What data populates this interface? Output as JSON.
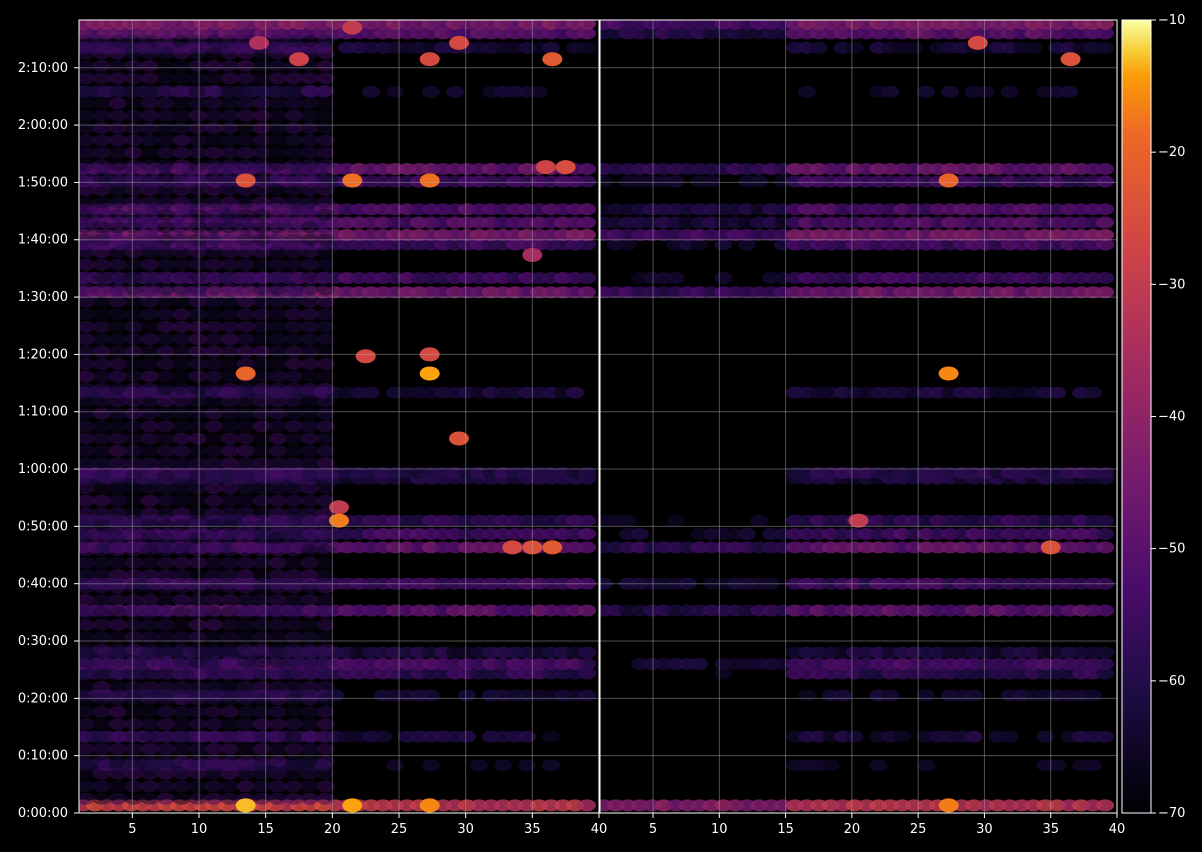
{
  "chart_data": {
    "type": "heatmap",
    "panels": [
      {
        "name": "",
        "xlim": [
          1,
          40
        ]
      },
      {
        "name": "",
        "xlim": [
          1,
          40
        ]
      }
    ],
    "x_ticks": [
      5,
      10,
      15,
      20,
      25,
      30,
      35,
      40
    ],
    "x_tick_labels": [
      "5",
      "10",
      "15",
      "20",
      "25",
      "30",
      "35",
      "40"
    ],
    "y_unit": "elapsed time (h:mm:ss)",
    "y_ticks": [
      0,
      600,
      1200,
      1800,
      2400,
      3000,
      3600,
      4200,
      4800,
      5400,
      6000,
      6600,
      7200,
      7800
    ],
    "y_tick_labels": [
      "0:00:00",
      "0:10:00",
      "0:20:00",
      "0:30:00",
      "0:40:00",
      "0:50:00",
      "1:00:00",
      "1:10:00",
      "1:20:00",
      "1:30:00",
      "1:40:00",
      "1:50:00",
      "2:00:00",
      "2:10:00"
    ],
    "ylim": [
      0,
      8300
    ],
    "colorbar": {
      "colormap": "inferno",
      "range": [
        -70,
        -10
      ],
      "ticks": [
        -10,
        -20,
        -30,
        -40,
        -50,
        -60,
        -70
      ],
      "tick_labels": [
        "−10",
        "−20",
        "−30",
        "−40",
        "−50",
        "−60",
        "−70"
      ]
    },
    "grid": true,
    "background": "#000000",
    "bands": [
      {
        "t": 80,
        "level": -32,
        "left_level": -28
      },
      {
        "t": 500,
        "level": -68,
        "left_level": -60
      },
      {
        "t": 800,
        "level": -63,
        "left_level": -57
      },
      {
        "t": 1230,
        "level": -65,
        "left_level": -60
      },
      {
        "t": 1460,
        "level": -58,
        "left_level": -58
      },
      {
        "t": 1560,
        "level": -54,
        "left_level": -54
      },
      {
        "t": 1680,
        "level": -62,
        "left_level": -60
      },
      {
        "t": 2120,
        "level": -50,
        "left_level": -52
      },
      {
        "t": 2400,
        "level": -55,
        "left_level": -55
      },
      {
        "t": 2780,
        "level": -48,
        "left_level": -54
      },
      {
        "t": 2920,
        "level": -55,
        "left_level": -56
      },
      {
        "t": 3060,
        "level": -58,
        "left_level": -57
      },
      {
        "t": 3500,
        "level": -62,
        "left_level": -60
      },
      {
        "t": 3560,
        "level": -60,
        "left_level": -56
      },
      {
        "t": 4400,
        "level": -63,
        "left_level": -58
      },
      {
        "t": 5450,
        "level": -46,
        "left_level": -46
      },
      {
        "t": 5600,
        "level": -55,
        "left_level": -56
      },
      {
        "t": 5950,
        "level": -55,
        "left_level": -54
      },
      {
        "t": 6050,
        "level": -45,
        "left_level": -45
      },
      {
        "t": 6180,
        "level": -52,
        "left_level": -52
      },
      {
        "t": 6320,
        "level": -52,
        "left_level": -52
      },
      {
        "t": 6610,
        "level": -56,
        "left_level": -56
      },
      {
        "t": 6740,
        "level": -48,
        "left_level": -52
      },
      {
        "t": 7550,
        "level": -66,
        "left_level": -60
      },
      {
        "t": 8010,
        "level": -63,
        "left_level": -57
      },
      {
        "t": 8160,
        "level": -50,
        "left_level": -48
      },
      {
        "t": 8260,
        "level": -44,
        "left_level": -42
      }
    ],
    "hotspots": [
      {
        "panel": 0,
        "x": 13.5,
        "t": 80,
        "v": -13
      },
      {
        "panel": 0,
        "x": 21.5,
        "t": 80,
        "v": -14
      },
      {
        "panel": 0,
        "x": 27.3,
        "t": 80,
        "v": -16
      },
      {
        "panel": 1,
        "x": 27.3,
        "t": 80,
        "v": -17
      },
      {
        "panel": 0,
        "x": 20.5,
        "t": 3200,
        "v": -30
      },
      {
        "panel": 0,
        "x": 33.5,
        "t": 2780,
        "v": -26
      },
      {
        "panel": 0,
        "x": 35,
        "t": 2780,
        "v": -24
      },
      {
        "panel": 0,
        "x": 36.5,
        "t": 2780,
        "v": -22
      },
      {
        "panel": 1,
        "x": 35,
        "t": 2780,
        "v": -24
      },
      {
        "panel": 0,
        "x": 20.5,
        "t": 3060,
        "v": -17
      },
      {
        "panel": 1,
        "x": 20.5,
        "t": 3060,
        "v": -30
      },
      {
        "panel": 0,
        "x": 29.5,
        "t": 3920,
        "v": -24
      },
      {
        "panel": 0,
        "x": 13.5,
        "t": 4600,
        "v": -20
      },
      {
        "panel": 0,
        "x": 27.3,
        "t": 4600,
        "v": -14
      },
      {
        "panel": 1,
        "x": 27.3,
        "t": 4600,
        "v": -16
      },
      {
        "panel": 0,
        "x": 27.3,
        "t": 4800,
        "v": -26
      },
      {
        "panel": 0,
        "x": 22.5,
        "t": 4780,
        "v": -26
      },
      {
        "panel": 0,
        "x": 35,
        "t": 5840,
        "v": -36
      },
      {
        "panel": 0,
        "x": 13.5,
        "t": 6620,
        "v": -24
      },
      {
        "panel": 0,
        "x": 21.5,
        "t": 6620,
        "v": -18
      },
      {
        "panel": 0,
        "x": 27.3,
        "t": 6620,
        "v": -18
      },
      {
        "panel": 1,
        "x": 27.3,
        "t": 6620,
        "v": -20
      },
      {
        "panel": 0,
        "x": 36,
        "t": 6760,
        "v": -28
      },
      {
        "panel": 0,
        "x": 37.5,
        "t": 6760,
        "v": -25
      },
      {
        "panel": 0,
        "x": 17.5,
        "t": 7890,
        "v": -28
      },
      {
        "panel": 0,
        "x": 27.3,
        "t": 7890,
        "v": -26
      },
      {
        "panel": 0,
        "x": 36.5,
        "t": 7890,
        "v": -22
      },
      {
        "panel": 1,
        "x": 36.5,
        "t": 7890,
        "v": -24
      },
      {
        "panel": 0,
        "x": 14.5,
        "t": 8060,
        "v": -34
      },
      {
        "panel": 0,
        "x": 29.5,
        "t": 8060,
        "v": -26
      },
      {
        "panel": 1,
        "x": 29.5,
        "t": 8060,
        "v": -26
      },
      {
        "panel": 0,
        "x": 21.5,
        "t": 8220,
        "v": -30
      }
    ]
  }
}
